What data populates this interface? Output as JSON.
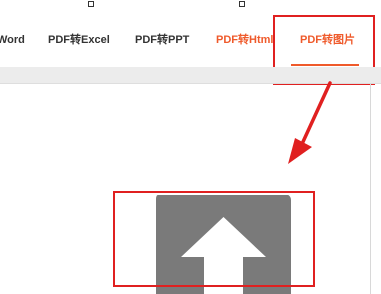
{
  "tabs": [
    {
      "label": "Word",
      "text": "Word",
      "color": "#333333"
    },
    {
      "label": "PDF转Excel",
      "color": "#333333"
    },
    {
      "label": "PDF转PPT",
      "color": "#333333"
    },
    {
      "label": "PDF转Html",
      "color": "#ef5a2b"
    },
    {
      "label": "PDF转图片",
      "color": "#ef5a2b",
      "active": true
    }
  ],
  "colors": {
    "accent": "#ef5a2b",
    "annotation": "#e02020",
    "upload_icon": "#7a7a7a"
  },
  "icons": {
    "upload": "upload-arrow-icon",
    "annotation_arrow": "red-pointer-arrow-icon"
  }
}
